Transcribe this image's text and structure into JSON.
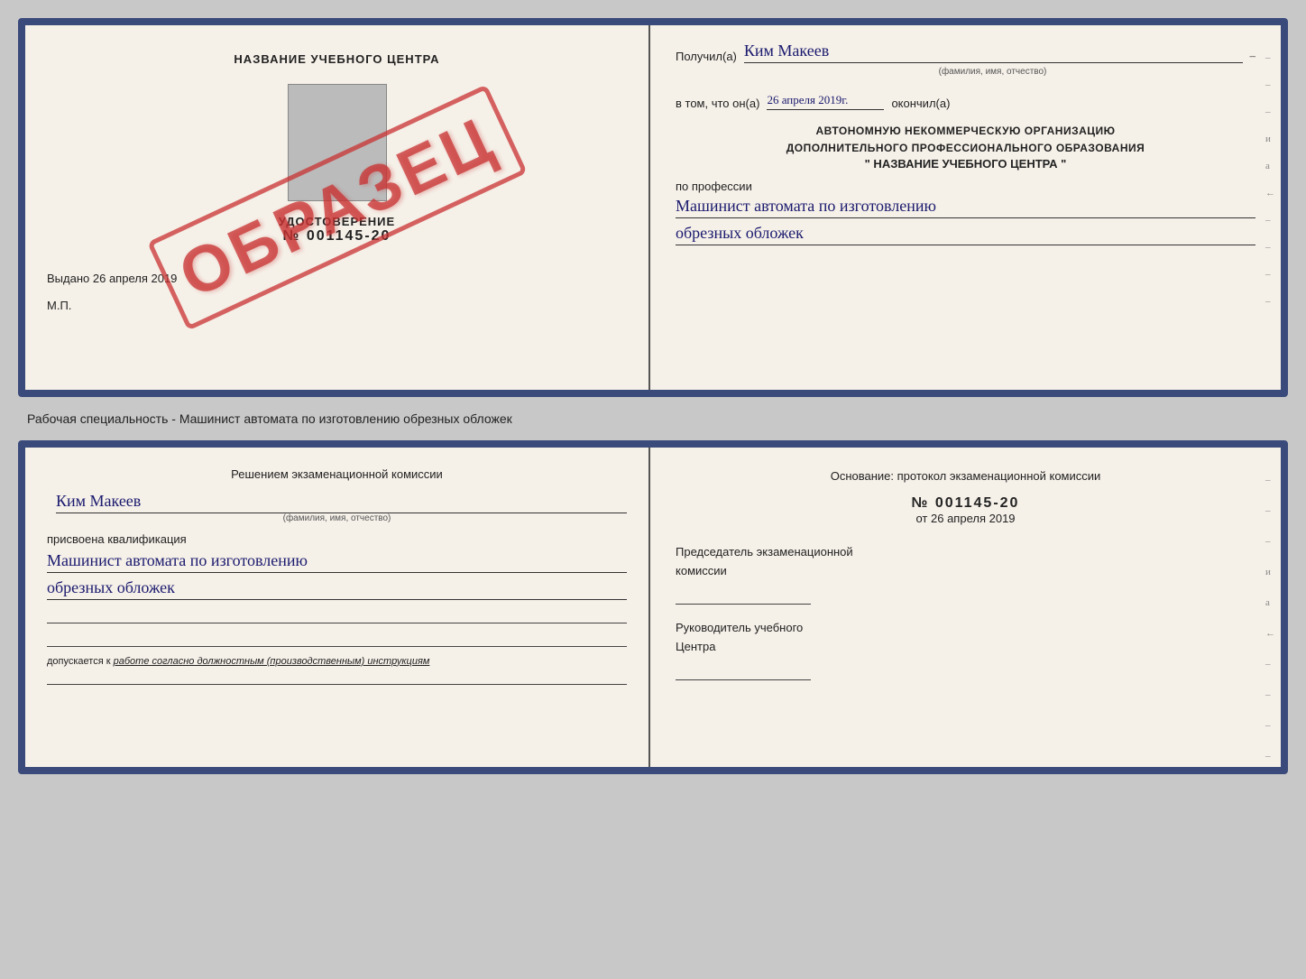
{
  "page": {
    "background": "#c8c8c8"
  },
  "topDoc": {
    "left": {
      "orgName": "НАЗВАНИЕ УЧЕБНОГО ЦЕНТРА",
      "stamp": "ОБРАЗЕЦ",
      "udostoverenie": "УДОСТОВЕРЕНИЕ",
      "number": "№ 001145-20",
      "vydano": "Выдано",
      "vydanoDate": "26 апреля 2019",
      "mp": "М.П."
    },
    "right": {
      "poluchilLabel": "Получил(а)",
      "recipientName": "Ким Макеев",
      "dash": "–",
      "fioHint": "(фамилия, имя, отчество)",
      "vtomLabel": "в том, что он(а)",
      "date": "26 апреля 2019г.",
      "okonchilLabel": "окончил(а)",
      "orgLine1": "АВТОНОМНУЮ НЕКОММЕРЧЕСКУЮ ОРГАНИЗАЦИЮ",
      "orgLine2": "ДОПОЛНИТЕЛЬНОГО ПРОФЕССИОНАЛЬНОГО ОБРАЗОВАНИЯ",
      "orgLine3": "\"   НАЗВАНИЕ УЧЕБНОГО ЦЕНТРА   \"",
      "poProfessiiLabel": "по профессии",
      "profession1": "Машинист автомата по изготовлению",
      "profession2": "обрезных обложек",
      "dashes": [
        "-",
        "-",
        "-",
        "и",
        "а",
        "←",
        "-",
        "-",
        "-",
        "-"
      ]
    }
  },
  "middleText": "Рабочая специальность - Машинист автомата по изготовлению обрезных обложек",
  "bottomDoc": {
    "left": {
      "resheniemLabel": "Решением экзаменационной комиссии",
      "name": "Ким Макеев",
      "fioHint": "(фамилия, имя, отчество)",
      "prisvoenaLabel": "присвоена квалификация",
      "qualification1": "Машинист автомата по изготовлению",
      "qualification2": "обрезных обложек",
      "dopuskaetsyaLabel": "допускается к",
      "dopuskaetsyaText": "работе согласно должностным (производственным) инструкциям"
    },
    "right": {
      "osnovanieLabelLine1": "Основание: протокол экзаменационной комиссии",
      "protokolNum": "№ 001145-20",
      "otLabel": "от",
      "otDate": "26 апреля 2019",
      "predsedatelLabel1": "Председатель экзаменационной",
      "predsedatelLabel2": "комиссии",
      "rukovoditelLabel1": "Руководитель учебного",
      "rukovoditelLabel2": "Центра",
      "dashes": [
        "-",
        "-",
        "-",
        "и",
        "а",
        "←",
        "-",
        "-",
        "-",
        "-"
      ]
    }
  }
}
